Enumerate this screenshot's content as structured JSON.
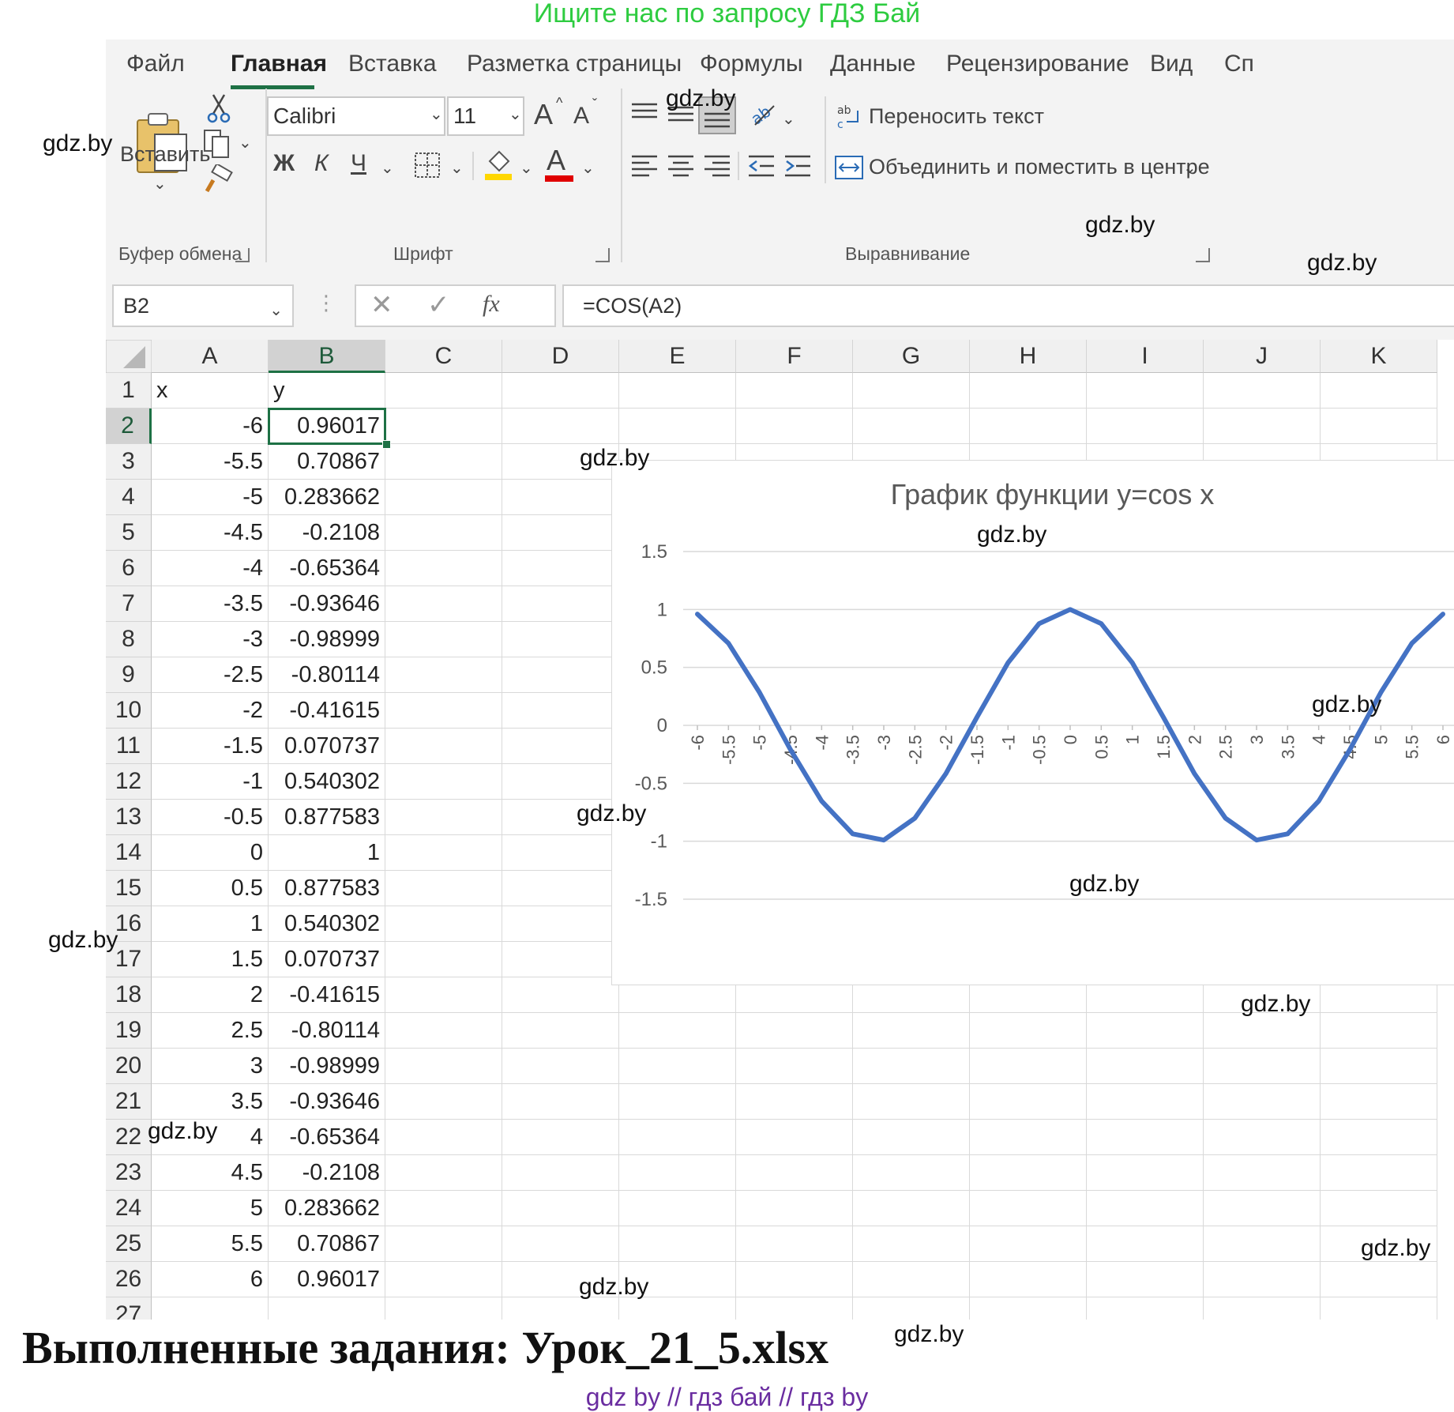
{
  "banner": "Ищите нас по запросу ГДЗ Бай",
  "ribbon": {
    "tabs": [
      "Файл",
      "Главная",
      "Вставка",
      "Разметка страницы",
      "Формулы",
      "Данные",
      "Рецензирование",
      "Вид",
      "Сп"
    ],
    "active_tab": "Главная",
    "clipboard": {
      "paste_label": "Вставить",
      "group_label": "Буфер обмена"
    },
    "font": {
      "name": "Calibri",
      "size": "11",
      "bold": "Ж",
      "italic": "К",
      "underline": "Ч",
      "grow": "A",
      "shrink": "A",
      "font_color_letter": "A",
      "group_label": "Шрифт"
    },
    "alignment": {
      "wrap_text": "Переносить текст",
      "merge_center": "Объединить и поместить в центре",
      "group_label": "Выравнивание"
    },
    "colors": {
      "accent": "#1e7145",
      "highlight": "#ffd700",
      "font_color": "#e00000"
    }
  },
  "formula_bar": {
    "cell_ref": "B2",
    "fx": "fx",
    "formula": "=COS(A2)"
  },
  "sheet": {
    "columns": [
      "A",
      "B",
      "C",
      "D",
      "E",
      "F",
      "G",
      "H",
      "I",
      "J",
      "K"
    ],
    "selected_column": "B",
    "selected_row": "2",
    "header_row": {
      "row": "1",
      "a": "x",
      "b": "y"
    },
    "rows": [
      {
        "row": "2",
        "a": "-6",
        "b": "0.96017"
      },
      {
        "row": "3",
        "a": "-5.5",
        "b": "0.70867"
      },
      {
        "row": "4",
        "a": "-5",
        "b": "0.283662"
      },
      {
        "row": "5",
        "a": "-4.5",
        "b": "-0.2108"
      },
      {
        "row": "6",
        "a": "-4",
        "b": "-0.65364"
      },
      {
        "row": "7",
        "a": "-3.5",
        "b": "-0.93646"
      },
      {
        "row": "8",
        "a": "-3",
        "b": "-0.98999"
      },
      {
        "row": "9",
        "a": "-2.5",
        "b": "-0.80114"
      },
      {
        "row": "10",
        "a": "-2",
        "b": "-0.41615"
      },
      {
        "row": "11",
        "a": "-1.5",
        "b": "0.070737"
      },
      {
        "row": "12",
        "a": "-1",
        "b": "0.540302"
      },
      {
        "row": "13",
        "a": "-0.5",
        "b": "0.877583"
      },
      {
        "row": "14",
        "a": "0",
        "b": "1"
      },
      {
        "row": "15",
        "a": "0.5",
        "b": "0.877583"
      },
      {
        "row": "16",
        "a": "1",
        "b": "0.540302"
      },
      {
        "row": "17",
        "a": "1.5",
        "b": "0.070737"
      },
      {
        "row": "18",
        "a": "2",
        "b": "-0.41615"
      },
      {
        "row": "19",
        "a": "2.5",
        "b": "-0.80114"
      },
      {
        "row": "20",
        "a": "3",
        "b": "-0.98999"
      },
      {
        "row": "21",
        "a": "3.5",
        "b": "-0.93646"
      },
      {
        "row": "22",
        "a": "4",
        "b": "-0.65364"
      },
      {
        "row": "23",
        "a": "4.5",
        "b": "-0.2108"
      },
      {
        "row": "24",
        "a": "5",
        "b": "0.283662"
      },
      {
        "row": "25",
        "a": "5.5",
        "b": "0.70867"
      },
      {
        "row": "26",
        "a": "6",
        "b": "0.96017"
      }
    ],
    "partial_row": "27"
  },
  "chart_data": {
    "type": "line",
    "title": "График функции y=cos x",
    "categories": [
      "-6",
      "-5.5",
      "-5",
      "-4.5",
      "-4",
      "-3.5",
      "-3",
      "-2.5",
      "-2",
      "-1.5",
      "-1",
      "-0.5",
      "0",
      "0.5",
      "1",
      "1.5",
      "2",
      "2.5",
      "3",
      "3.5",
      "4",
      "4.5",
      "5",
      "5.5",
      "6"
    ],
    "values": [
      0.96017,
      0.70867,
      0.283662,
      -0.2108,
      -0.65364,
      -0.93646,
      -0.98999,
      -0.80114,
      -0.41615,
      0.070737,
      0.540302,
      0.877583,
      1,
      0.877583,
      0.540302,
      0.070737,
      -0.41615,
      -0.80114,
      -0.98999,
      -0.93646,
      -0.65364,
      -0.2108,
      0.283662,
      0.70867,
      0.96017
    ],
    "y_ticks": [
      "1.5",
      "1",
      "0.5",
      "0",
      "-0.5",
      "-1",
      "-1.5"
    ],
    "ylim": [
      -1.5,
      1.5
    ],
    "grid": true,
    "legend": "none",
    "line_color": "#4472c4",
    "xlabel": "",
    "ylabel": ""
  },
  "watermark": "gdz.by",
  "footer": {
    "title": "Выполненные задания: Урок_21_5.xlsx",
    "links": "gdz by  //  гдз бай  //  гдз by"
  }
}
